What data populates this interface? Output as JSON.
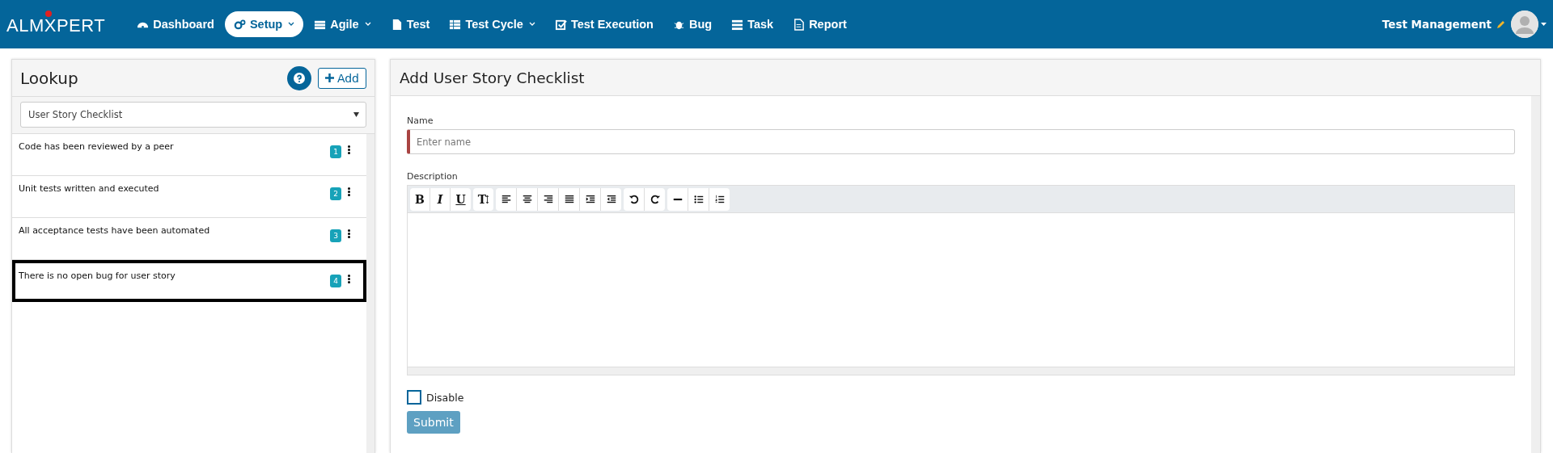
{
  "navbar": {
    "logo": "ALMXPERT",
    "items": [
      {
        "label": "Dashboard",
        "caret": false,
        "selected": false
      },
      {
        "label": "Setup",
        "caret": true,
        "selected": true
      },
      {
        "label": "Agile",
        "caret": true,
        "selected": false
      },
      {
        "label": "Test",
        "caret": false,
        "selected": false
      },
      {
        "label": "Test Cycle",
        "caret": true,
        "selected": false
      },
      {
        "label": "Test Execution",
        "caret": false,
        "selected": false
      },
      {
        "label": "Bug",
        "caret": false,
        "selected": false
      },
      {
        "label": "Task",
        "caret": false,
        "selected": false
      },
      {
        "label": "Report",
        "caret": false,
        "selected": false
      }
    ],
    "user": "Test Management"
  },
  "lookup": {
    "title": "Lookup",
    "add_button": "Add",
    "dropdown": "User Story Checklist",
    "items": [
      {
        "text": "Code has been reviewed by a peer",
        "number": "1",
        "selected": false
      },
      {
        "text": "Unit tests written and executed",
        "number": "2",
        "selected": false
      },
      {
        "text": "All acceptance tests have been automated",
        "number": "3",
        "selected": false
      },
      {
        "text": "There is no open bug for user story",
        "number": "4",
        "selected": true
      }
    ]
  },
  "form": {
    "title": "Add User Story Checklist",
    "name_label": "Name",
    "name_placeholder": "Enter name",
    "description_label": "Description",
    "toolbar": [
      [
        {
          "kind": "text",
          "label": "B"
        },
        {
          "kind": "text",
          "label": "I"
        },
        {
          "kind": "text",
          "label": "U"
        }
      ],
      [
        {
          "kind": "textsize",
          "label": "T"
        }
      ],
      [
        {
          "kind": "align-left"
        },
        {
          "kind": "align-center"
        },
        {
          "kind": "align-right"
        },
        {
          "kind": "justify"
        },
        {
          "kind": "indent"
        },
        {
          "kind": "outdent"
        }
      ],
      [
        {
          "kind": "undo"
        },
        {
          "kind": "redo"
        }
      ],
      [
        {
          "kind": "rule"
        },
        {
          "kind": "bullets"
        },
        {
          "kind": "numbers"
        }
      ]
    ],
    "disable": {
      "label": "Disable",
      "checked": false
    },
    "submit": "Submit"
  }
}
